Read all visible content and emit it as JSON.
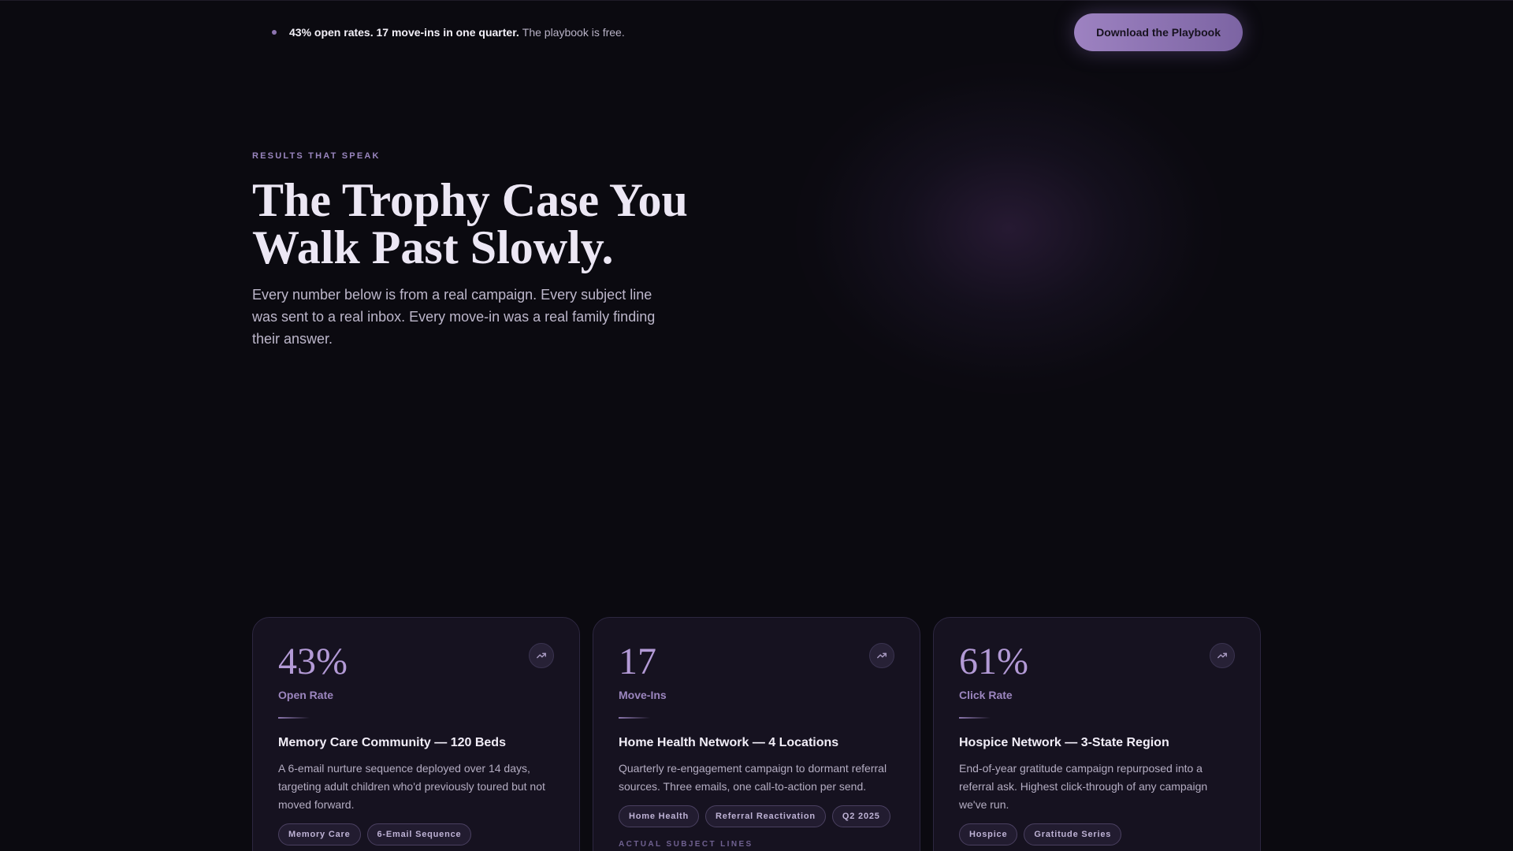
{
  "topbar": {
    "announcement_bold": "43% open rates. 17 move-ins in one quarter.",
    "announcement_rest": "The playbook is free.",
    "cta_label": "Download the Playbook"
  },
  "hero": {
    "eyebrow": "RESULTS THAT SPEAK",
    "title_line1": "The Trophy Case You",
    "title_line2": "Walk Past Slowly.",
    "subtitle": "Every number below is from a real campaign. Every subject line was sent to a real inbox. Every move-in was a real family finding their answer."
  },
  "cards": [
    {
      "stat": "43%",
      "stat_label": "Open Rate",
      "title": "Memory Care Community — 120 Beds",
      "description": "A 6-email nurture sequence deployed over 14 days, targeting adult children who'd previously toured but not moved forward.",
      "tags": [
        "Memory Care",
        "6-Email Sequence"
      ],
      "icon": "trend-up-icon"
    },
    {
      "stat": "17",
      "stat_label": "Move-Ins",
      "title": "Home Health Network — 4 Locations",
      "description": "Quarterly re-engagement campaign to dormant referral sources. Three emails, one call-to-action per send.",
      "tags": [
        "Home Health",
        "Referral Reactivation",
        "Q2 2025"
      ],
      "subhead": "ACTUAL SUBJECT LINES",
      "icon": "trend-up-icon"
    },
    {
      "stat": "61%",
      "stat_label": "Click Rate",
      "title": "Hospice Network — 3-State Region",
      "description": "End-of-year gratitude campaign repurposed into a referral ask. Highest click-through of any campaign we've run.",
      "tags": [
        "Hospice",
        "Gratitude Series"
      ],
      "icon": "trend-up-icon"
    }
  ],
  "colors": {
    "background": "#0b0a10",
    "accent": "#9d82c1",
    "card": "#161220"
  }
}
